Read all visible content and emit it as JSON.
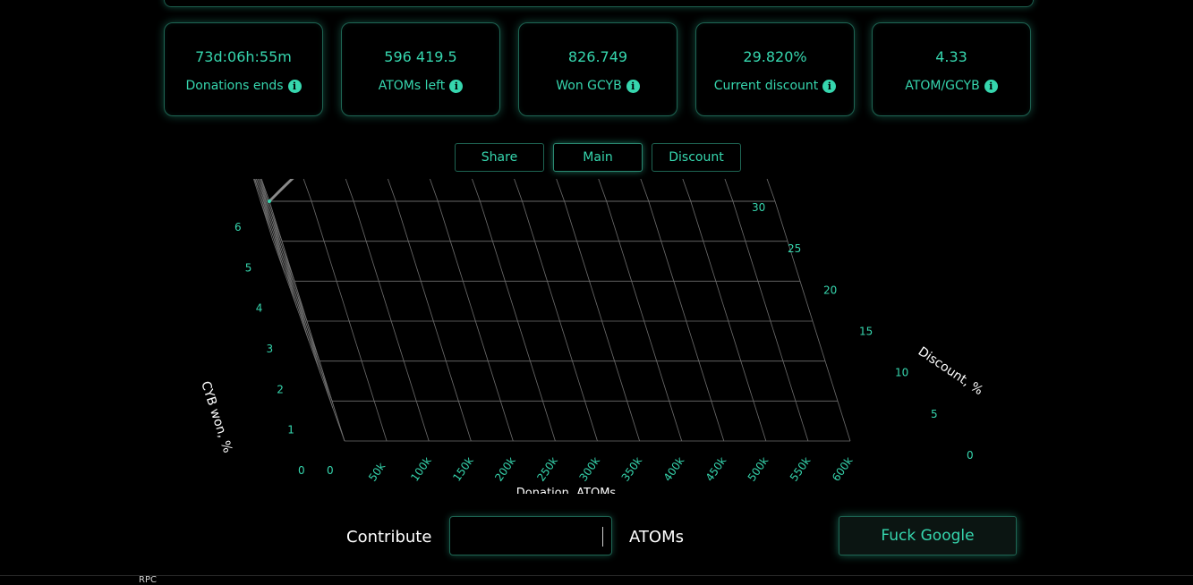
{
  "stats": [
    {
      "value": "73d:06h:55m",
      "label": "Donations ends"
    },
    {
      "value": "596 419.5",
      "label": "ATOMs left"
    },
    {
      "value": "826.749",
      "label": "Won GCYB"
    },
    {
      "value": "29.820%",
      "label": "Current discount"
    },
    {
      "value": "4.33",
      "label": "ATOM/GCYB"
    }
  ],
  "tabs": [
    {
      "label": "Share"
    },
    {
      "label": "Main",
      "active": true
    },
    {
      "label": "Discount"
    }
  ],
  "chart_data": {
    "type": "line",
    "title": "",
    "xlabel": "Donation, ATOMs",
    "ylabel": "Discount, %",
    "zlabel": "CYB won, %",
    "x_ticks": [
      "0",
      "50k",
      "100k",
      "150k",
      "200k",
      "250k",
      "300k",
      "350k",
      "400k",
      "450k",
      "500k",
      "550k",
      "600k"
    ],
    "y_ticks": [
      "0",
      "5",
      "10",
      "15",
      "20",
      "25",
      "30"
    ],
    "z_ticks": [
      "0",
      "1",
      "2",
      "3",
      "4",
      "5",
      "6"
    ],
    "xlim": [
      0,
      600000
    ],
    "ylim": [
      0,
      30
    ],
    "zlim": [
      0,
      6
    ],
    "series": [
      {
        "x": [
          0,
          50000,
          100000,
          150000,
          200000,
          250000,
          300000,
          350000,
          400000,
          450000,
          500000,
          550000,
          600000
        ],
        "y": [
          30,
          30,
          30,
          30,
          30,
          30,
          30,
          30,
          30,
          30,
          30,
          30,
          30
        ],
        "z": [
          0.0,
          0.9,
          1.6,
          2.05,
          2.3,
          2.45,
          2.55,
          2.65,
          2.8,
          3.05,
          3.5,
          4.2,
          5.1
        ],
        "color": "#8a8a8a"
      }
    ],
    "grid": true
  },
  "contribute": {
    "label": "Contribute",
    "value": "",
    "unit": "ATOMs",
    "button": "Fuck Google"
  },
  "footer": {
    "rpc": "RPC"
  }
}
